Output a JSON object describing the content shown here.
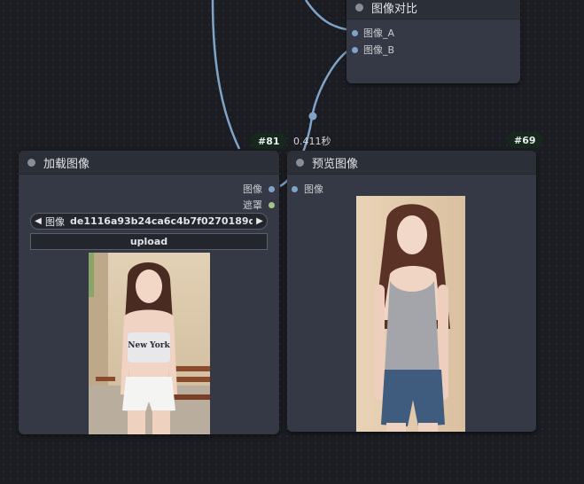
{
  "nodes": {
    "compare": {
      "title": "图像对比",
      "inputs": [
        "图像_A",
        "图像_B"
      ]
    },
    "load_image": {
      "title": "加载图像",
      "id_badge": "#81",
      "outputs": [
        "图像",
        "遮罩"
      ],
      "image_widget": {
        "label": "图像",
        "value": "de1116a93b24ca6c4b7f0270189dc..."
      },
      "upload_label": "upload",
      "preview_shirt_text": "New York"
    },
    "preview_image": {
      "title": "预览图像",
      "id_badge": "#69",
      "inputs": [
        "图像"
      ],
      "exec_time": "0.411秒"
    }
  },
  "colors": {
    "image_link": "#7fa4c8",
    "mask_slot": "#a8c58a",
    "node_body": "#353945",
    "node_header": "#2b2f38",
    "badge_bg": "#16281c"
  },
  "icons": {
    "combo_left": "triangle-left-icon",
    "combo_right": "triangle-right-icon",
    "node_collapse": "circle-dot-icon"
  }
}
